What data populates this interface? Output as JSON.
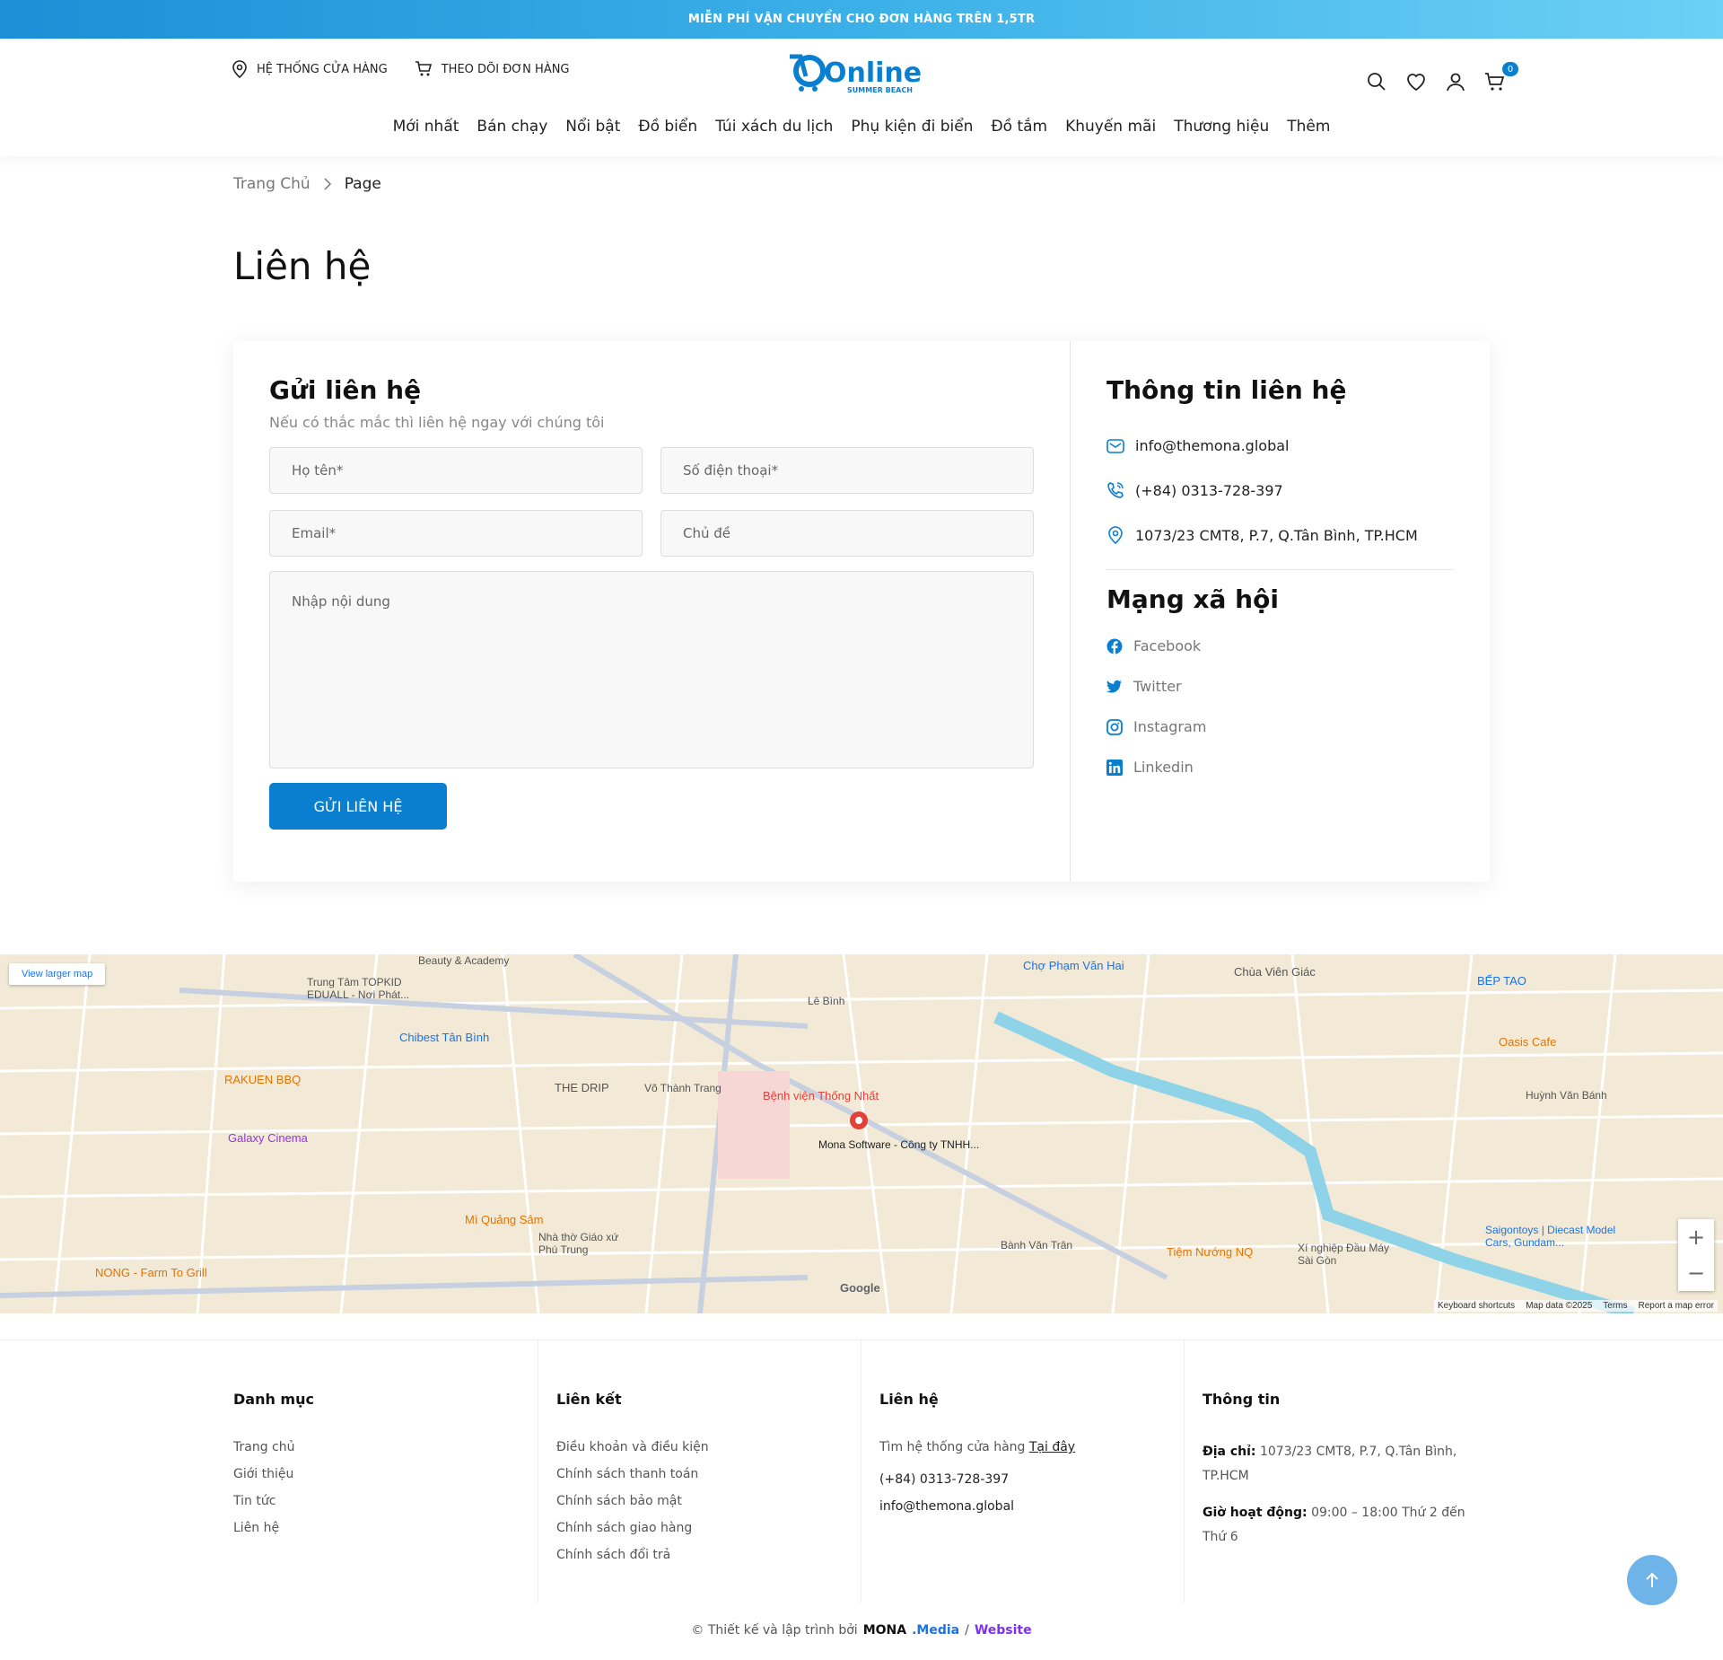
{
  "topbar": {
    "text": "MIỄN PHÍ VẬN CHUYỂN CHO ĐƠN HÀNG TRÊN 1,5TR"
  },
  "header": {
    "store_system": "HỆ THỐNG CỬA HÀNG",
    "track_order": "THEO DÕI ĐƠN HÀNG",
    "logo_text": "Online",
    "logo_sub": "SUMMER BEACH",
    "cart_count": "0"
  },
  "nav": {
    "items": [
      "Mới nhất",
      "Bán chạy",
      "Nổi bật",
      "Đồ biển",
      "Túi xách du lịch",
      "Phụ kiện đi biển",
      "Đồ tắm",
      "Khuyến mãi",
      "Thương hiệu",
      "Thêm"
    ]
  },
  "breadcrumb": {
    "home": "Trang Chủ",
    "current": "Page"
  },
  "page_title": "Liên hệ",
  "form": {
    "title": "Gửi liên hệ",
    "subtitle": "Nếu có thắc mắc thì liên hệ ngay với chúng tôi",
    "name_placeholder": "Họ tên*",
    "phone_placeholder": "Số điện thoại*",
    "email_placeholder": "Email*",
    "subject_placeholder": "Chủ đề",
    "message_placeholder": "Nhập nội dung",
    "submit": "GỬI LIÊN HỆ"
  },
  "contact_info": {
    "title": "Thông tin liên hệ",
    "email": "info@themona.global",
    "phone": "(+84) 0313-728-397",
    "address": "1073/23 CMT8, P.7, Q.Tân Bình, TP.HCM"
  },
  "social": {
    "title": "Mạng xã hội",
    "items": [
      "Facebook",
      "Twitter",
      "Instagram",
      "Linkedin"
    ]
  },
  "map": {
    "view_larger": "View larger map",
    "marker_label": "Mona Software - Công ty TNHH...",
    "labels": [
      "Bệnh viện Thống Nhất",
      "Chợ Phạm Văn Hai",
      "Chùa Viên Giác",
      "BẾP TAO",
      "Oasis Cafe",
      "Chibest Tân Bình",
      "RAKUEN BBQ",
      "Galaxy Cinema",
      "THE DRIP",
      "Mì Quảng Sâm",
      "Tiệm Nướng NQ",
      "Saigontoys | Diecast Model Cars, Gundam...",
      "NONG - Farm To Grill",
      "Trung Tâm TOPKID EDUALL - Nơi Phát...",
      "Beauty & Academy",
      "Nhà thờ Giáo xứ Phú Trung",
      "Xí nghiệp Đầu Máy Sài Gòn",
      "Bành Văn Trân",
      "Huỳnh Văn Bánh",
      "Lê Bình",
      "Võ Thành Trang"
    ],
    "zoom_in": "+",
    "zoom_out": "−",
    "attribution": [
      "Keyboard shortcuts",
      "Map data ©2025",
      "Terms",
      "Report a map error"
    ],
    "google": "Google"
  },
  "footer": {
    "categories": {
      "title": "Danh mục",
      "items": [
        "Trang chủ",
        "Giới thiệu",
        "Tin tức",
        "Liên hệ"
      ]
    },
    "links": {
      "title": "Liên kết",
      "items": [
        "Điều khoản và điều kiện",
        "Chính sách thanh toán",
        "Chính sách bảo mật",
        "Chính sách giao hàng",
        "Chính sách đổi trả"
      ]
    },
    "contact": {
      "title": "Liên hệ",
      "store_text": "Tìm hệ thống cửa hàng",
      "store_link": "Tại đây",
      "phone": "(+84) 0313-728-397",
      "email": "info@themona.global"
    },
    "info": {
      "title": "Thông tin",
      "address_label": "Địa chỉ:",
      "address": "1073/23 CMT8, P.7, Q.Tân Bình, TP.HCM",
      "hours_label": "Giờ hoạt động:",
      "hours": "09:00 – 18:00 Thứ 2 đến Thứ 6"
    },
    "copyright": "© Thiết kế và lập trình bởi",
    "brand": "MONA",
    "brand_media": ".Media",
    "brand_sep": "/",
    "brand_website": "Website"
  },
  "colors": {
    "accent": "#0a7fd0",
    "topbar_start": "#1c8fd6",
    "topbar_end": "#6dd0f5"
  }
}
